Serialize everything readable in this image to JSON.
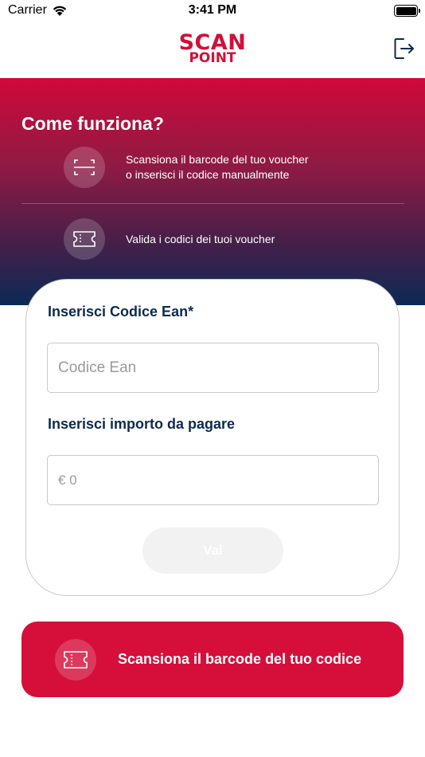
{
  "status_bar": {
    "carrier": "Carrier",
    "time": "3:41 PM"
  },
  "header": {
    "logo_line1": "SCAN",
    "logo_line2": "POINT",
    "brand_color": "#d0103a"
  },
  "hero": {
    "title": "Come funziona?",
    "steps": [
      {
        "line1": "Scansiona il barcode del tuo voucher",
        "line2": "o inserisci il codice manualmente",
        "icon": "barcode-scan-icon"
      },
      {
        "line1": "Valida i codici dei tuoi voucher",
        "icon": "ticket-icon"
      }
    ],
    "gradient": [
      "#d0093b",
      "#0b2a55"
    ]
  },
  "form": {
    "ean_label": "Inserisci Codice Ean*",
    "ean_placeholder": "Codice Ean",
    "ean_value": "",
    "amount_label": "Inserisci importo da pagare",
    "amount_placeholder": "€ 0",
    "amount_value": "",
    "submit_label": "Vai"
  },
  "scan_button": {
    "label": "Scansiona il barcode del tuo codice",
    "icon": "ticket-icon",
    "color": "#d50f3a"
  }
}
